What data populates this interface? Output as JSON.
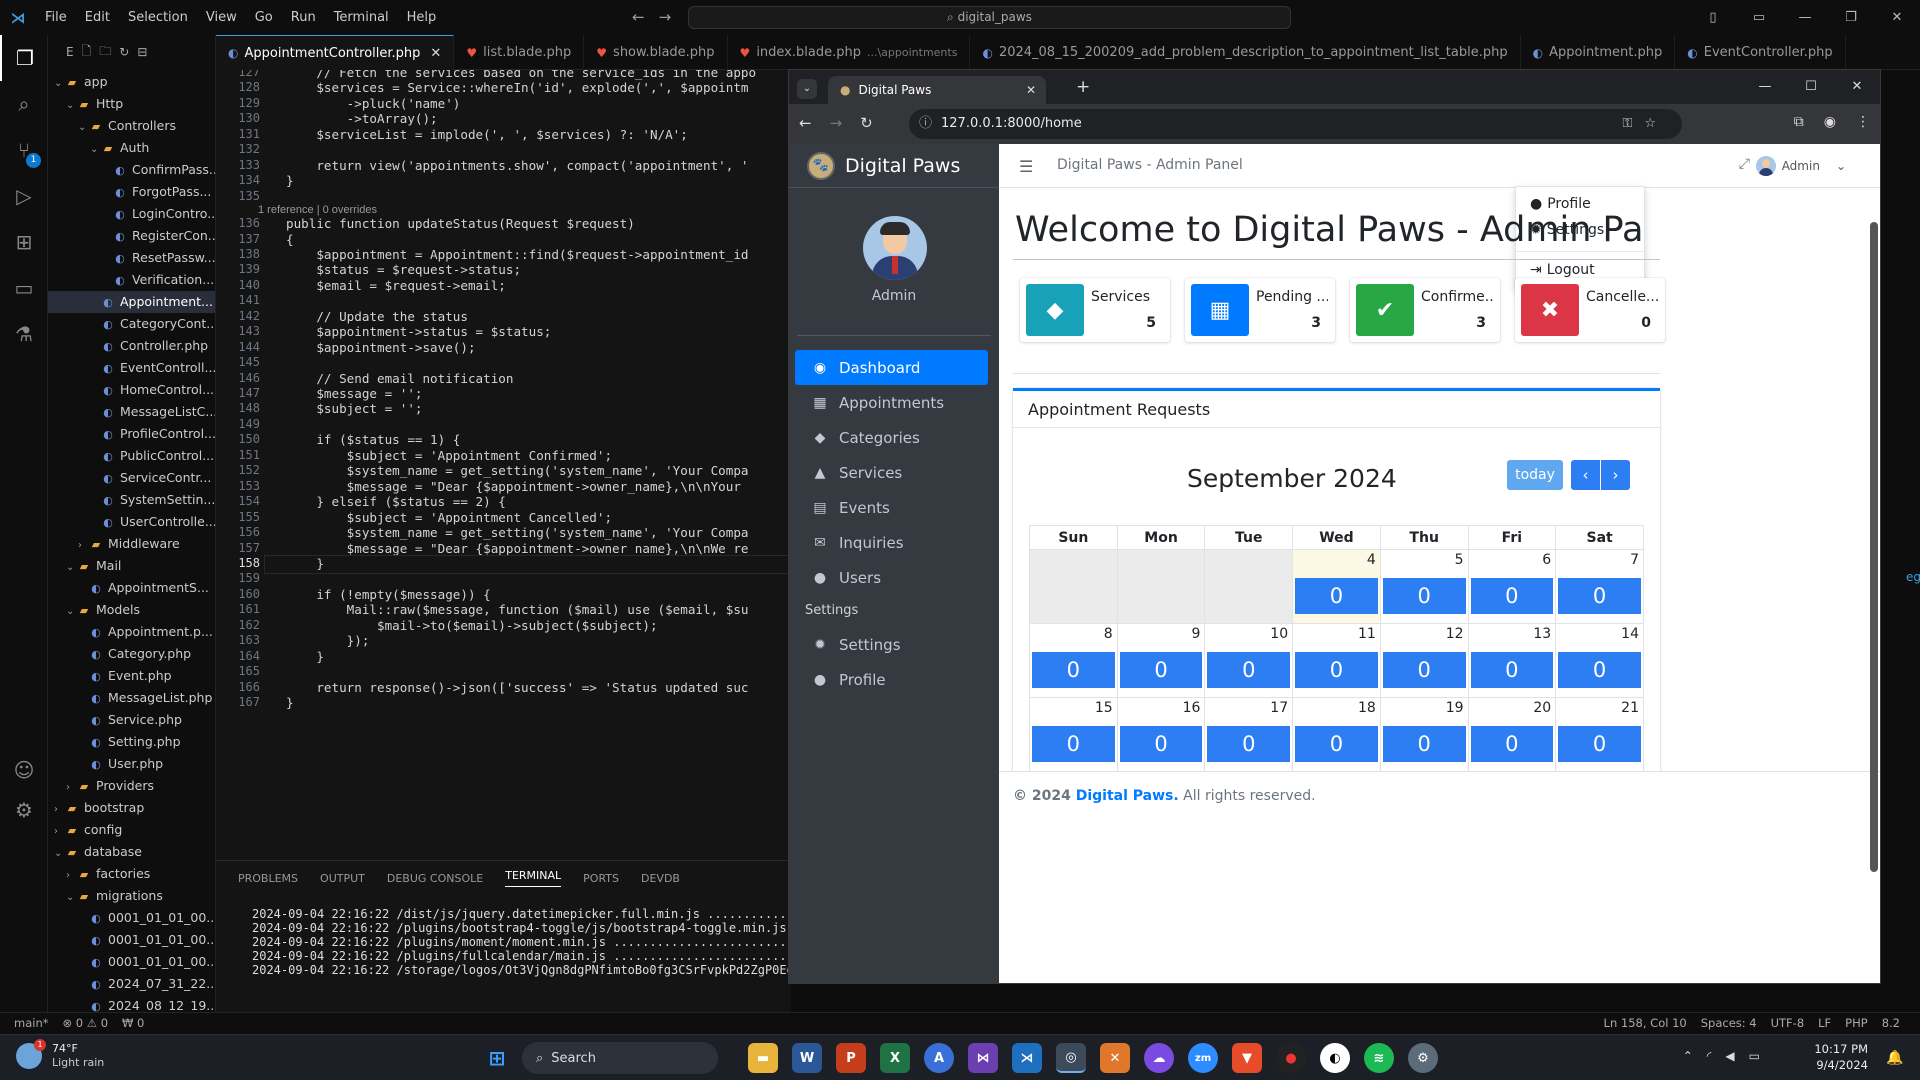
{
  "vscode": {
    "menu": [
      "File",
      "Edit",
      "Selection",
      "View",
      "Go",
      "Run",
      "Terminal",
      "Help"
    ],
    "search": "digital_paws",
    "explorer_header": "E",
    "tree": [
      {
        "label": "app",
        "kind": "folder",
        "depth": 0,
        "open": true
      },
      {
        "label": "Http",
        "kind": "folder",
        "depth": 1,
        "open": true
      },
      {
        "label": "Controllers",
        "kind": "folder",
        "depth": 2,
        "open": true
      },
      {
        "label": "Auth",
        "kind": "folder",
        "depth": 3,
        "open": true
      },
      {
        "label": "ConfirmPass...",
        "kind": "php",
        "depth": 4
      },
      {
        "label": "ForgotPass...",
        "kind": "php",
        "depth": 4
      },
      {
        "label": "LoginContro...",
        "kind": "php",
        "depth": 4
      },
      {
        "label": "RegisterCon...",
        "kind": "php",
        "depth": 4
      },
      {
        "label": "ResetPassw...",
        "kind": "php",
        "depth": 4
      },
      {
        "label": "Verification...",
        "kind": "php",
        "depth": 4
      },
      {
        "label": "Appointment...",
        "kind": "php",
        "depth": 3,
        "selected": true
      },
      {
        "label": "CategoryCont...",
        "kind": "php",
        "depth": 3
      },
      {
        "label": "Controller.php",
        "kind": "php",
        "depth": 3
      },
      {
        "label": "EventControll...",
        "kind": "php",
        "depth": 3
      },
      {
        "label": "HomeControl...",
        "kind": "php",
        "depth": 3
      },
      {
        "label": "MessageListC...",
        "kind": "php",
        "depth": 3
      },
      {
        "label": "ProfileControl...",
        "kind": "php",
        "depth": 3
      },
      {
        "label": "PublicControl...",
        "kind": "php",
        "depth": 3
      },
      {
        "label": "ServiceContr...",
        "kind": "php",
        "depth": 3
      },
      {
        "label": "SystemSettin...",
        "kind": "php",
        "depth": 3
      },
      {
        "label": "UserControlle...",
        "kind": "php",
        "depth": 3
      },
      {
        "label": "Middleware",
        "kind": "folder",
        "depth": 2,
        "open": false
      },
      {
        "label": "Mail",
        "kind": "folder",
        "depth": 1,
        "open": true
      },
      {
        "label": "AppointmentS...",
        "kind": "php",
        "depth": 2
      },
      {
        "label": "Models",
        "kind": "folder",
        "depth": 1,
        "open": true
      },
      {
        "label": "Appointment.p...",
        "kind": "php",
        "depth": 2
      },
      {
        "label": "Category.php",
        "kind": "php",
        "depth": 2
      },
      {
        "label": "Event.php",
        "kind": "php",
        "depth": 2
      },
      {
        "label": "MessageList.php",
        "kind": "php",
        "depth": 2
      },
      {
        "label": "Service.php",
        "kind": "php",
        "depth": 2
      },
      {
        "label": "Setting.php",
        "kind": "php",
        "depth": 2
      },
      {
        "label": "User.php",
        "kind": "php",
        "depth": 2
      },
      {
        "label": "Providers",
        "kind": "folder",
        "depth": 1,
        "open": false
      },
      {
        "label": "bootstrap",
        "kind": "folder",
        "depth": 0,
        "open": false
      },
      {
        "label": "config",
        "kind": "folder",
        "depth": 0,
        "open": false
      },
      {
        "label": "database",
        "kind": "folder",
        "depth": 0,
        "open": true
      },
      {
        "label": "factories",
        "kind": "folder",
        "depth": 1,
        "open": false
      },
      {
        "label": "migrations",
        "kind": "folder",
        "depth": 1,
        "open": true
      },
      {
        "label": "0001_01_01_00...",
        "kind": "php",
        "depth": 2
      },
      {
        "label": "0001_01_01_00...",
        "kind": "php",
        "depth": 2
      },
      {
        "label": "0001_01_01_00...",
        "kind": "php",
        "depth": 2
      },
      {
        "label": "2024_07_31_22...",
        "kind": "php",
        "depth": 2
      },
      {
        "label": "2024_08_12_19...",
        "kind": "php",
        "depth": 2
      }
    ],
    "tabs": [
      {
        "label": "AppointmentController.php",
        "active": true,
        "icon": "php"
      },
      {
        "label": "list.blade.php",
        "icon": "blade"
      },
      {
        "label": "show.blade.php",
        "icon": "blade"
      },
      {
        "label": "index.blade.php",
        "hint": "...\\appointments",
        "icon": "blade"
      },
      {
        "label": "2024_08_15_200209_add_problem_description_to_appointment_list_table.php",
        "icon": "php"
      },
      {
        "label": "Appointment.php",
        "icon": "php"
      },
      {
        "label": "EventController.php",
        "icon": "php"
      }
    ],
    "code_lens": "1 reference | 0 overrides",
    "line_numbers": [
      "127",
      "128",
      "129",
      "130",
      "131",
      "132",
      "133",
      "134",
      "135",
      "136",
      "137",
      "138",
      "139",
      "140",
      "141",
      "142",
      "143",
      "144",
      "145",
      "146",
      "147",
      "148",
      "149",
      "150",
      "151",
      "152",
      "153",
      "154",
      "155",
      "156",
      "157",
      "158",
      "159",
      "160",
      "161",
      "162",
      "163",
      "164",
      "165",
      "166",
      "167"
    ],
    "code_lines": [
      "    // Fetch the services based on the service_ids in the appo",
      "    $services = Service::whereIn('id', explode(',', $appointm",
      "        ->pluck('name')",
      "        ->toArray();",
      "    $serviceList = implode(', ', $services) ?: 'N/A';",
      "",
      "    return view('appointments.show', compact('appointment', '",
      "}",
      "",
      "public function updateStatus(Request $request)",
      "{",
      "    $appointment = Appointment::find($request->appointment_id",
      "    $status = $request->status;",
      "    $email = $request->email;",
      "",
      "    // Update the status",
      "    $appointment->status = $status;",
      "    $appointment->save();",
      "",
      "    // Send email notification",
      "    $message = '';",
      "    $subject = '';",
      "",
      "    if ($status == 1) {",
      "        $subject = 'Appointment Confirmed';",
      "        $system_name = get_setting('system_name', 'Your Compa",
      "        $message = \"Dear {$appointment->owner_name},\\n\\nYour",
      "    } elseif ($status == 2) {",
      "        $subject = 'Appointment Cancelled';",
      "        $system_name = get_setting('system_name', 'Your Compa",
      "        $message = \"Dear {$appointment->owner_name},\\n\\nWe re",
      "    }",
      "",
      "    if (!empty($message)) {",
      "        Mail::raw($message, function ($mail) use ($email, $su",
      "            $mail->to($email)->subject($subject);",
      "        });",
      "    }",
      "",
      "    return response()->json(['success' => 'Status updated suc",
      "}"
    ],
    "current_line": "158",
    "panel_tabs": [
      "PROBLEMS",
      "OUTPUT",
      "DEBUG CONSOLE",
      "TERMINAL",
      "PORTS",
      "DEVDB"
    ],
    "active_panel_tab": "TERMINAL",
    "terminal": [
      "2024-09-04 22:16:22 /dist/js/jquery.datetimepicker.full.min.js ...............",
      "2024-09-04 22:16:22 /plugins/bootstrap4-toggle/js/bootstrap4-toggle.min.js ....",
      "2024-09-04 22:16:22 /plugins/moment/moment.min.js .............................",
      "2024-09-04 22:16:22 /plugins/fullcalendar/main.js .............................",
      "2024-09-04 22:16:22 /storage/logos/Ot3VjQgn8dgPNfimtoBo0fg3CSrFvpkPd2ZgP0Eg.png"
    ],
    "status_left": [
      "main*",
      "⊗ 0 ⚠ 0",
      "₩ 0"
    ],
    "status_right": [
      "Ln 158, Col 10",
      "Spaces: 4",
      "UTF-8",
      "LF",
      "PHP",
      "8.2"
    ],
    "edge_text": "egard"
  },
  "chrome": {
    "tab_title": "Digital Paws",
    "url": "127.0.0.1:8000/home"
  },
  "admin": {
    "brand": "Digital Paws",
    "user_name": "Admin",
    "nav": [
      {
        "label": "Dashboard",
        "icon": "dashboard-icon",
        "glyph": "◉",
        "active": true
      },
      {
        "label": "Appointments",
        "icon": "calendar-icon",
        "glyph": "▦"
      },
      {
        "label": "Categories",
        "icon": "tags-icon",
        "glyph": "◆"
      },
      {
        "label": "Services",
        "icon": "bell-icon",
        "glyph": "▲"
      },
      {
        "label": "Events",
        "icon": "calendar-event-icon",
        "glyph": "▤"
      },
      {
        "label": "Inquiries",
        "icon": "envelope-icon",
        "glyph": "✉"
      },
      {
        "label": "Users",
        "icon": "users-icon",
        "glyph": "●"
      }
    ],
    "nav_header": "Settings",
    "nav2": [
      {
        "label": "Settings",
        "icon": "gear-icon",
        "glyph": "✹"
      },
      {
        "label": "Profile",
        "icon": "user-icon",
        "glyph": "●"
      }
    ],
    "topbar_title": "Digital Paws - Admin Panel",
    "topbar_user": "Admin",
    "dropdown": {
      "profile": "Profile",
      "settings": "Settings",
      "logout": "Logout"
    },
    "welcome": "Welcome to Digital Paws - Admin Pa",
    "info_boxes": [
      {
        "label": "Services",
        "value": "5",
        "color": "#17a2b8",
        "icon": "tag-icon",
        "glyph": "◆"
      },
      {
        "label": "Pending ...",
        "value": "3",
        "color": "#007bff",
        "icon": "calendar-icon",
        "glyph": "▦"
      },
      {
        "label": "Confirme...",
        "value": "3",
        "color": "#28a745",
        "icon": "calendar-check-icon",
        "glyph": "✔"
      },
      {
        "label": "Cancelle...",
        "value": "0",
        "color": "#dc3545",
        "icon": "calendar-x-icon",
        "glyph": "✖"
      }
    ],
    "card_title": "Appointment Requests",
    "calendar": {
      "month": "September 2024",
      "today_label": "today",
      "days": [
        "Sun",
        "Mon",
        "Tue",
        "Wed",
        "Thu",
        "Fri",
        "Sat"
      ],
      "rows": [
        [
          null,
          null,
          null,
          {
            "d": "4",
            "e": "0",
            "today": true
          },
          {
            "d": "5",
            "e": "0"
          },
          {
            "d": "6",
            "e": "0"
          },
          {
            "d": "7",
            "e": "0"
          }
        ],
        [
          {
            "d": "8",
            "e": "0"
          },
          {
            "d": "9",
            "e": "0"
          },
          {
            "d": "10",
            "e": "0"
          },
          {
            "d": "11",
            "e": "0"
          },
          {
            "d": "12",
            "e": "0"
          },
          {
            "d": "13",
            "e": "0"
          },
          {
            "d": "14",
            "e": "0"
          }
        ],
        [
          {
            "d": "15",
            "e": "0"
          },
          {
            "d": "16",
            "e": "0"
          },
          {
            "d": "17",
            "e": "0"
          },
          {
            "d": "18",
            "e": "0"
          },
          {
            "d": "19",
            "e": "0"
          },
          {
            "d": "20",
            "e": "0"
          },
          {
            "d": "21",
            "e": "0"
          }
        ]
      ]
    },
    "footer": {
      "prefix": "© 2024 ",
      "brand": "Digital Paws.",
      "suffix": " All rights reserved."
    }
  },
  "taskbar": {
    "temp": "74°F",
    "weather": "Light rain",
    "weather_badge": "1",
    "search": "Search",
    "time": "10:17 PM",
    "date": "9/4/2024"
  }
}
